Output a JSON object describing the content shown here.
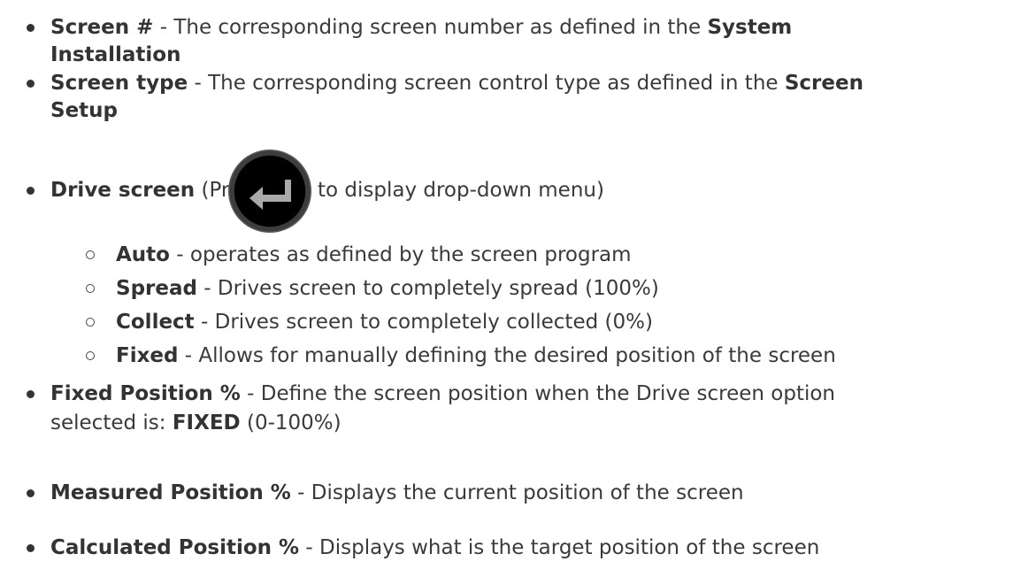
{
  "items": [
    {
      "term": "Screen #",
      "sep": " - ",
      "desc_line1": "The corresponding screen number as defined in the ",
      "ref1": "System",
      "ref2": "Installation"
    },
    {
      "term": "Screen type",
      "sep": " - ",
      "desc_line1": "The corresponding screen control type as defined in the ",
      "ref1": "Screen",
      "ref2": "Setup"
    },
    {
      "term": "Drive screen",
      "text_before": " (Press ",
      "text_after": " to display drop-down menu)",
      "icon": "enter-key-icon",
      "options": [
        {
          "term": "Auto",
          "sep": " - ",
          "desc": "operates as defined by the screen program"
        },
        {
          "term": "Spread",
          "sep": " - ",
          "desc": "Drives screen to completely spread (100%)"
        },
        {
          "term": "Collect",
          "sep": " - ",
          "desc": "Drives screen to completely collected (0%)"
        },
        {
          "term": "Fixed",
          "sep": " - ",
          "desc": "Allows for manually defining the desired position of the screen"
        }
      ]
    },
    {
      "term": "Fixed Position %",
      "sep": " - ",
      "desc_line1": "Define the screen position when the Drive screen option",
      "desc_line2_pre": "selected is:  ",
      "value": "FIXED",
      "desc_line2_post": " (0-100%)"
    },
    {
      "term": "Measured Position %",
      "sep": " - ",
      "desc": "Displays the current position of the screen"
    },
    {
      "term": "Calculated Position %",
      "sep": " - ",
      "desc": "Displays what is the target position of the screen"
    }
  ],
  "colors": {
    "text": "#3a3a3a",
    "bold_text": "#333333"
  }
}
